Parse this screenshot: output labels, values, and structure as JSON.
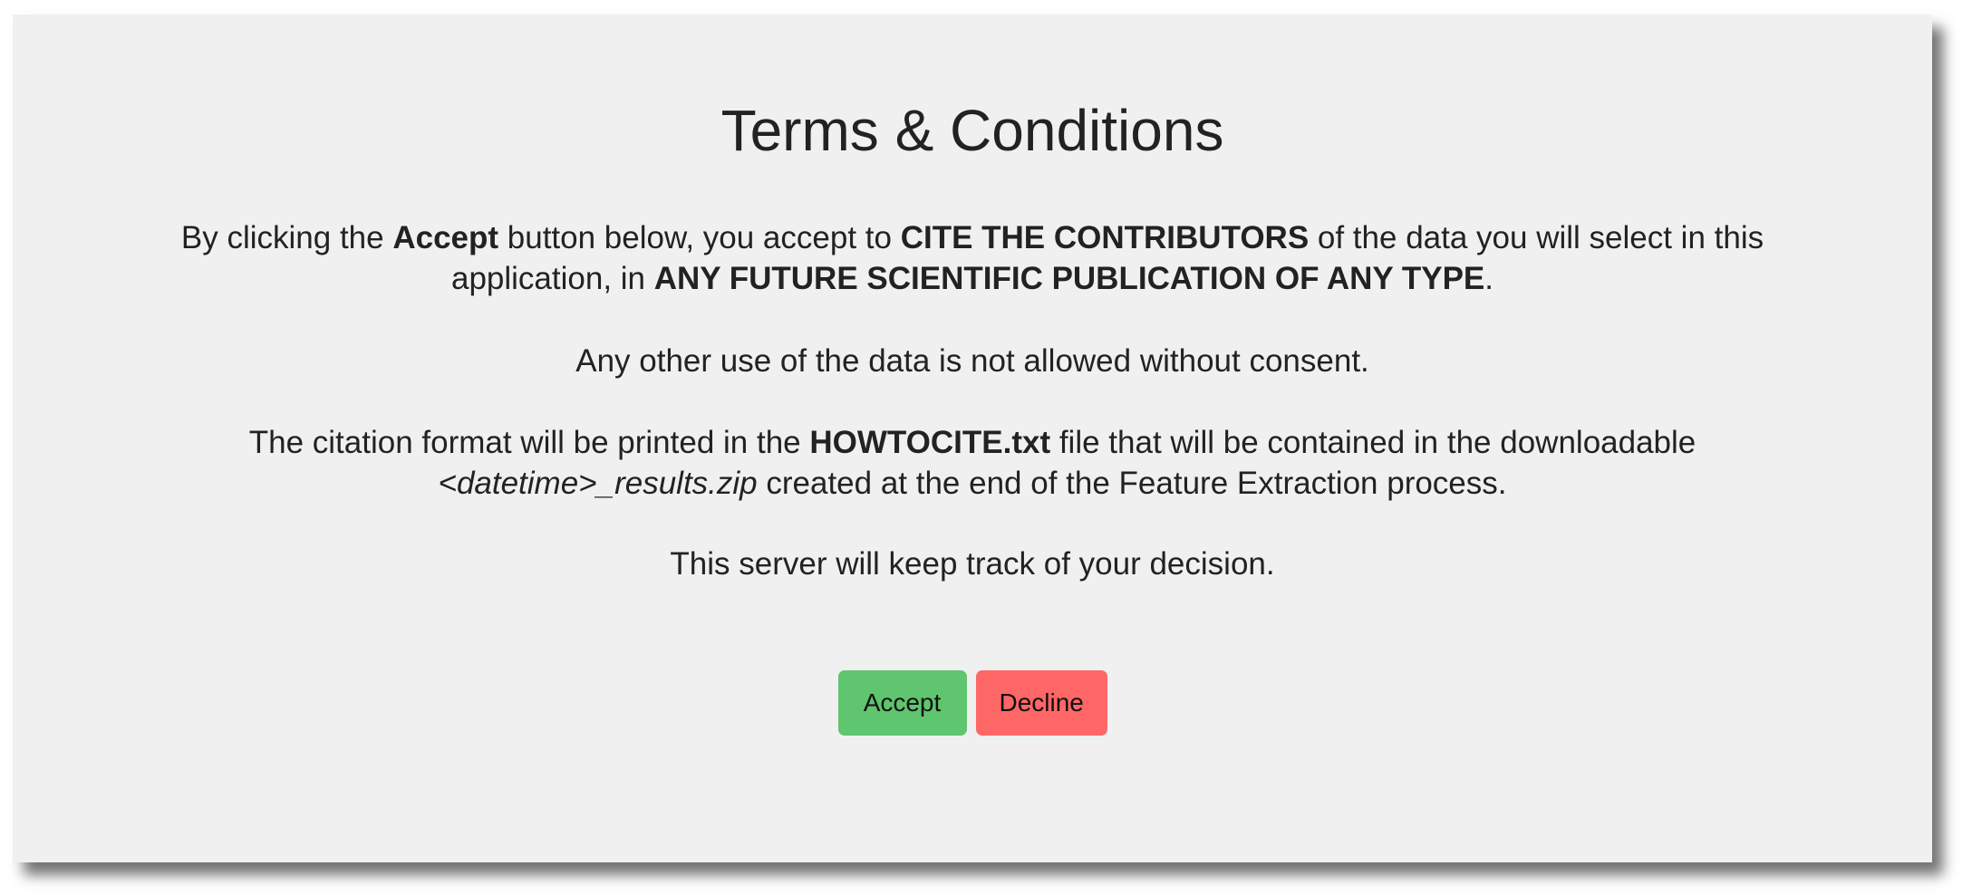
{
  "dialog": {
    "title": "Terms & Conditions",
    "p1": {
      "a": "By clicking the ",
      "b": "Accept",
      "c": " button below, you accept to ",
      "d": "CITE THE CONTRIBUTORS",
      "e": " of the data you will select in this",
      "f": "application, in ",
      "g": "ANY FUTURE SCIENTIFIC PUBLICATION OF ANY TYPE",
      "h": "."
    },
    "p2": "Any other use of the data is not allowed without consent.",
    "p3": {
      "a": "The citation format will be printed in the ",
      "b": "HOWTOCITE.txt",
      "c": " file that will be contained in the downloadable",
      "d": "<datetime>_results.zip",
      "e": " created at the end of the Feature Extraction process."
    },
    "p4": "This server will keep track of your decision.",
    "accept_label": "Accept",
    "decline_label": "Decline"
  },
  "colors": {
    "accept": "#5fc56e",
    "decline": "#ff6666",
    "panel": "#f0f0f0"
  }
}
